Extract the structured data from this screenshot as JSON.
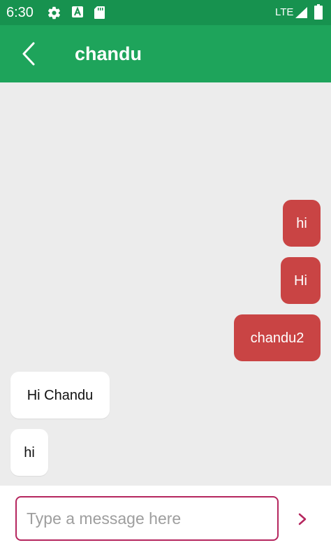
{
  "status_bar": {
    "time": "6:30",
    "network_label": "LTE",
    "icons": [
      "gear-icon",
      "font-a-icon",
      "sd-card-icon",
      "signal-icon",
      "battery-icon"
    ]
  },
  "app_bar": {
    "title": "chandu",
    "back_icon": "chevron-left-icon",
    "background_color": "#1ea45b"
  },
  "messages": [
    {
      "direction": "sent",
      "text": "hi"
    },
    {
      "direction": "sent",
      "text": "Hi"
    },
    {
      "direction": "sent",
      "text": "chandu2"
    },
    {
      "direction": "received",
      "text": "Hi Chandu"
    },
    {
      "direction": "received",
      "text": "hi"
    }
  ],
  "composer": {
    "placeholder": "Type a message here",
    "value": "",
    "send_icon": "chevron-right-icon"
  },
  "colors": {
    "status_bar": "#17924f",
    "sent_bubble": "#c94444",
    "received_bubble": "#ffffff",
    "chat_background": "#ececec",
    "input_border": "#b5265e"
  }
}
